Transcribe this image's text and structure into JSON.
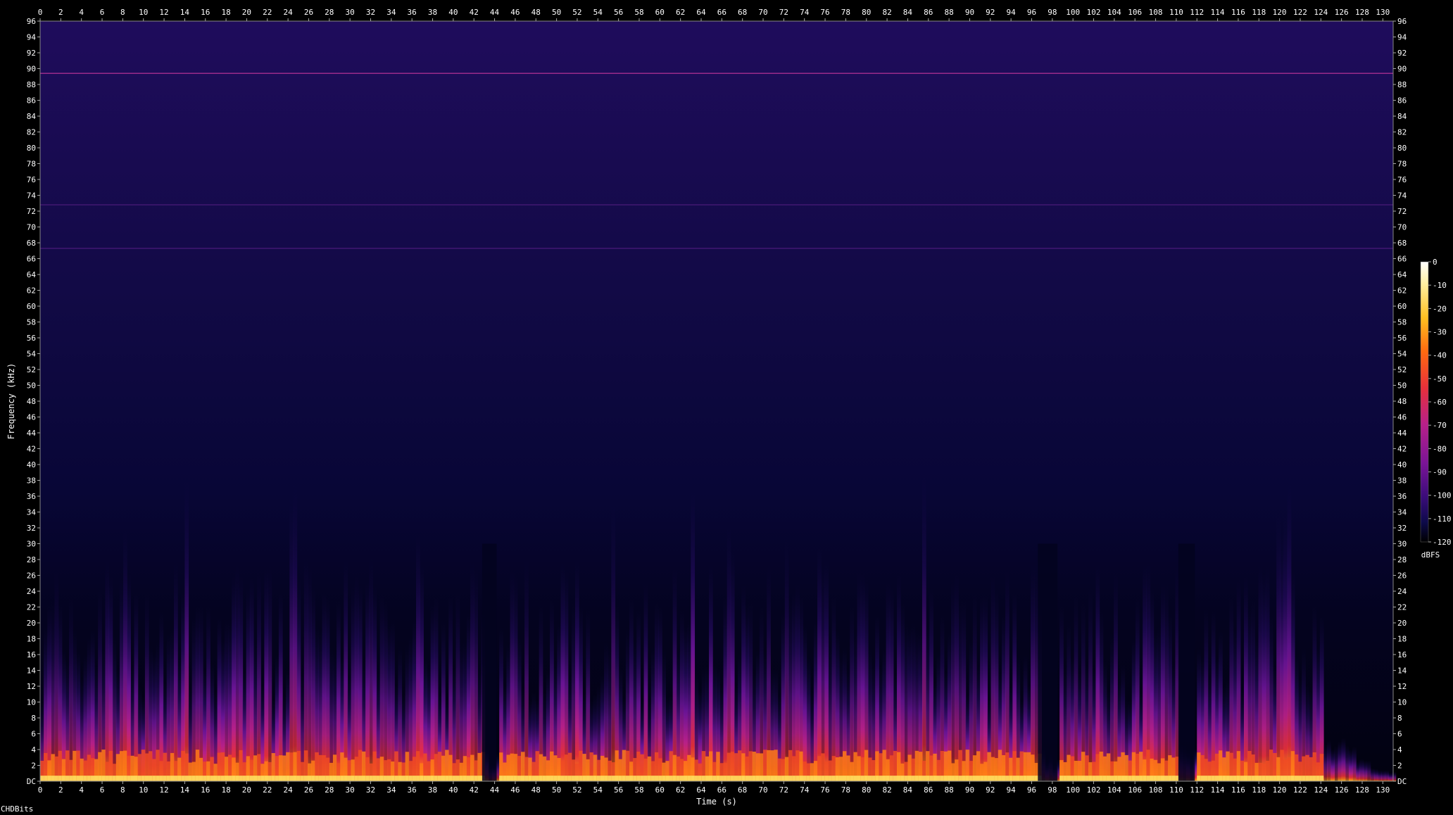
{
  "chart_data": {
    "type": "heatmap",
    "subtype": "spectrogram",
    "xlabel": "Time (s)",
    "ylabel": "Frequency (kHz)",
    "xlim": [
      0,
      131
    ],
    "ylim": [
      0,
      96
    ],
    "x_ticks": [
      0,
      2,
      4,
      6,
      8,
      10,
      12,
      14,
      16,
      18,
      20,
      22,
      24,
      26,
      28,
      30,
      32,
      34,
      36,
      38,
      40,
      42,
      44,
      46,
      48,
      50,
      52,
      54,
      56,
      58,
      60,
      62,
      64,
      66,
      68,
      70,
      72,
      74,
      76,
      78,
      80,
      82,
      84,
      86,
      88,
      90,
      92,
      94,
      96,
      98,
      100,
      102,
      104,
      106,
      108,
      110,
      112,
      114,
      116,
      118,
      120,
      122,
      124,
      126,
      128,
      130
    ],
    "y_ticks": [
      "DC",
      "2",
      "4",
      "6",
      "8",
      "10",
      "12",
      "14",
      "16",
      "18",
      "20",
      "22",
      "24",
      "26",
      "28",
      "30",
      "32",
      "34",
      "36",
      "38",
      "40",
      "42",
      "44",
      "46",
      "48",
      "50",
      "52",
      "54",
      "56",
      "58",
      "60",
      "62",
      "64",
      "66",
      "68",
      "70",
      "72",
      "74",
      "76",
      "78",
      "80",
      "82",
      "84",
      "86",
      "88",
      "90",
      "92",
      "94",
      "96"
    ],
    "colorbar": {
      "label": "dBFS",
      "ticks": [
        "0",
        "-10",
        "-20",
        "-30",
        "-40",
        "-50",
        "-60",
        "-70",
        "-80",
        "-90",
        "-100",
        "-110",
        "-120"
      ],
      "range": [
        -120,
        0
      ],
      "colors": [
        "#000000",
        "#0d0a4a",
        "#3a0c7a",
        "#7a1496",
        "#b8208a",
        "#e8303a",
        "#ff6a10",
        "#ffc020",
        "#fff8c0",
        "#ffffff"
      ]
    },
    "horizontal_lines_khz": [
      89.4,
      72.8,
      67.3
    ],
    "quiet_gaps_s": [
      [
        42.8,
        44.2
      ],
      [
        96.6,
        98.5
      ],
      [
        110.2,
        111.8
      ]
    ],
    "activity_segments_s": [
      [
        0,
        42.8
      ],
      [
        44.2,
        96.6
      ],
      [
        98.5,
        110.2
      ],
      [
        111.8,
        124
      ]
    ],
    "fade_out_s": [
      122,
      131
    ]
  },
  "footer": {
    "credit": "CHDBits"
  }
}
